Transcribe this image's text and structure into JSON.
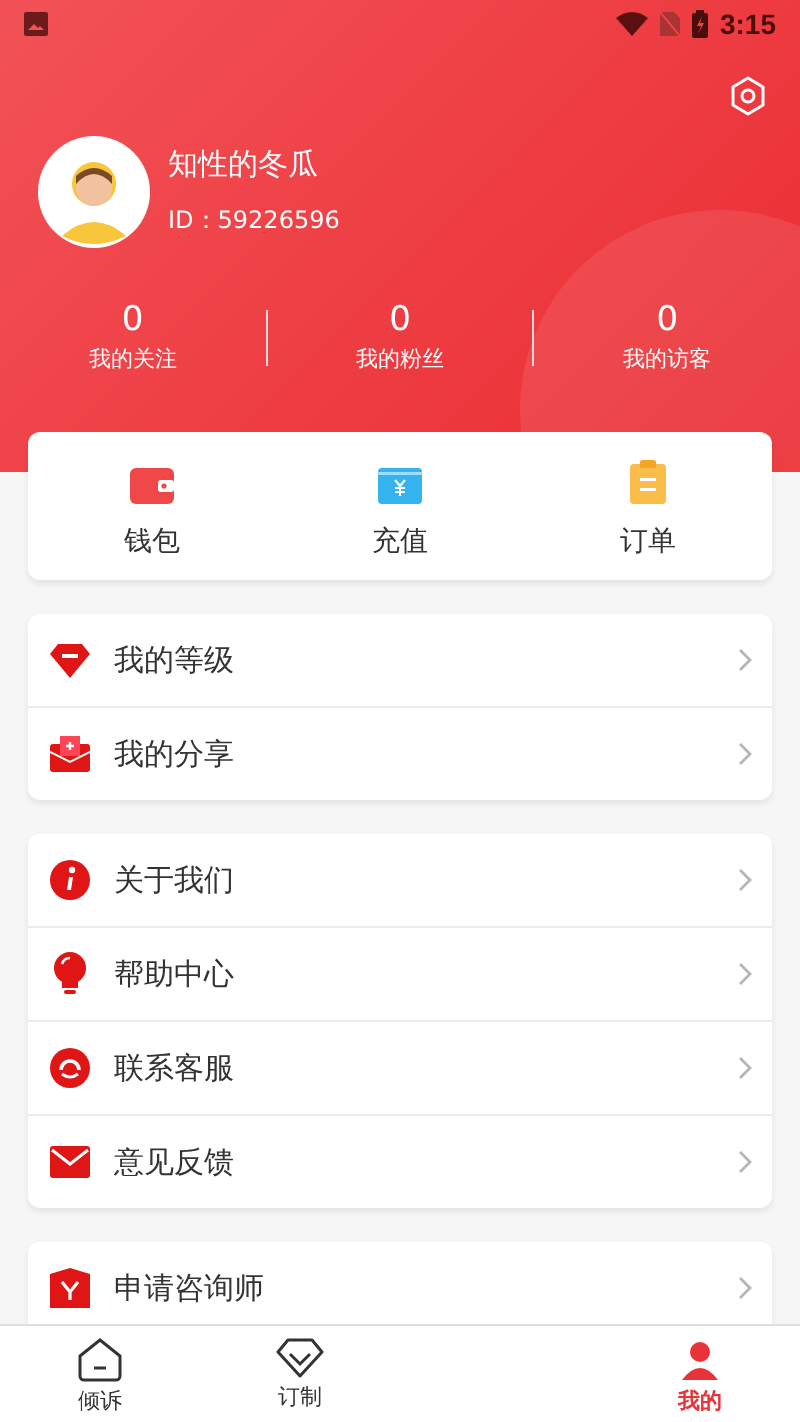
{
  "status_bar": {
    "time": "3:15"
  },
  "profile": {
    "name": "知性的冬瓜",
    "id": "ID：59226596"
  },
  "stats": [
    {
      "value": "0",
      "label": "我的关注"
    },
    {
      "value": "0",
      "label": "我的粉丝"
    },
    {
      "value": "0",
      "label": "我的访客"
    }
  ],
  "quick_actions": [
    {
      "kind": "wallet",
      "label": "钱包"
    },
    {
      "kind": "recharge",
      "label": "充值"
    },
    {
      "kind": "order",
      "label": "订单"
    }
  ],
  "menu_groups": [
    [
      {
        "kind": "level",
        "label": "我的等级"
      },
      {
        "kind": "share",
        "label": "我的分享"
      }
    ],
    [
      {
        "kind": "about",
        "label": "关于我们"
      },
      {
        "kind": "help",
        "label": "帮助中心"
      },
      {
        "kind": "service",
        "label": "联系客服"
      },
      {
        "kind": "feedback",
        "label": "意见反馈"
      }
    ],
    [
      {
        "kind": "apply",
        "label": "申请咨询师"
      }
    ]
  ],
  "bottom_nav": [
    {
      "kind": "home",
      "label": "倾诉",
      "selected": false
    },
    {
      "kind": "custom",
      "label": "订制",
      "selected": false
    },
    {
      "kind": "me",
      "label": "我的",
      "selected": true
    }
  ]
}
